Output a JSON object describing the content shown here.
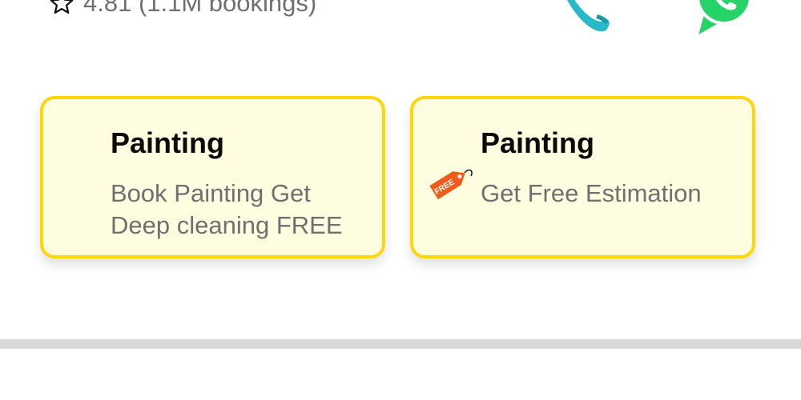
{
  "header": {
    "rating_text": "4.81 (1.1M bookings)",
    "icons": [
      "star-icon",
      "phone-icon",
      "whatsapp-icon"
    ]
  },
  "offers": [
    {
      "title": "Painting",
      "description_lines": [
        "Book Painting Get",
        "Deep cleaning FREE"
      ]
    },
    {
      "title": "Painting",
      "description_lines": [
        "Get Free Estimation"
      ],
      "tag_icon": "free-tag-icon",
      "tag_text": "FREE"
    }
  ],
  "colors": {
    "card_background": "#fefde0",
    "card_border": "#ffd60a",
    "title_text": "#0b0b0b",
    "secondary_text": "#707070",
    "phone_icon": "#26b9c8",
    "whatsapp": "#25d366",
    "free_tag": "#f05a1a",
    "divider": "#d9d9d9"
  }
}
